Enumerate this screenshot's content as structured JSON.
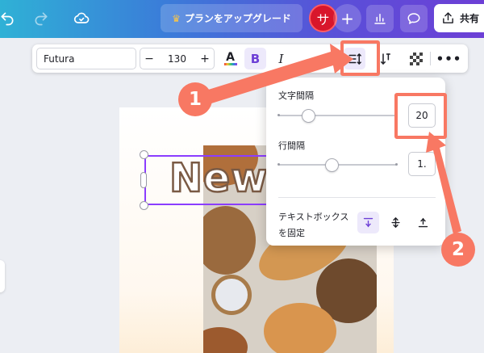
{
  "header": {
    "upgrade_label": "プランをアップグレード",
    "avatar_initial": "サ",
    "add_symbol": "+",
    "share_label": "共有"
  },
  "toolbar": {
    "font_name": "Futura",
    "size_minus": "−",
    "font_size": "130",
    "size_plus": "+",
    "color_glyph": "A",
    "bold_glyph": "B",
    "italic_glyph": "I",
    "more_glyph": "•••"
  },
  "canvas": {
    "text": "New"
  },
  "spacing_panel": {
    "letter_spacing_label": "文字間隔",
    "letter_spacing_value": "20",
    "letter_spacing_level": 0.25,
    "line_spacing_label": "行間隔",
    "line_spacing_value": "1.",
    "line_spacing_level": 0.45,
    "anchor_label": "テキストボックスを固定",
    "anchor_options": [
      "top",
      "middle",
      "bottom"
    ],
    "anchor_selected": "top"
  },
  "annotations": {
    "step1": "1",
    "step2": "2",
    "color": "#f87863"
  },
  "icons": [
    "undo-icon",
    "redo-icon",
    "cloud-check-icon",
    "crown-icon",
    "insights-icon",
    "comment-icon",
    "share-icon",
    "letter-spacing-icon",
    "text-orientation-icon",
    "transparency-icon"
  ],
  "colors": {
    "accent": "#8b3dff",
    "avatar": "#d8162b",
    "annotation": "#f87863"
  }
}
